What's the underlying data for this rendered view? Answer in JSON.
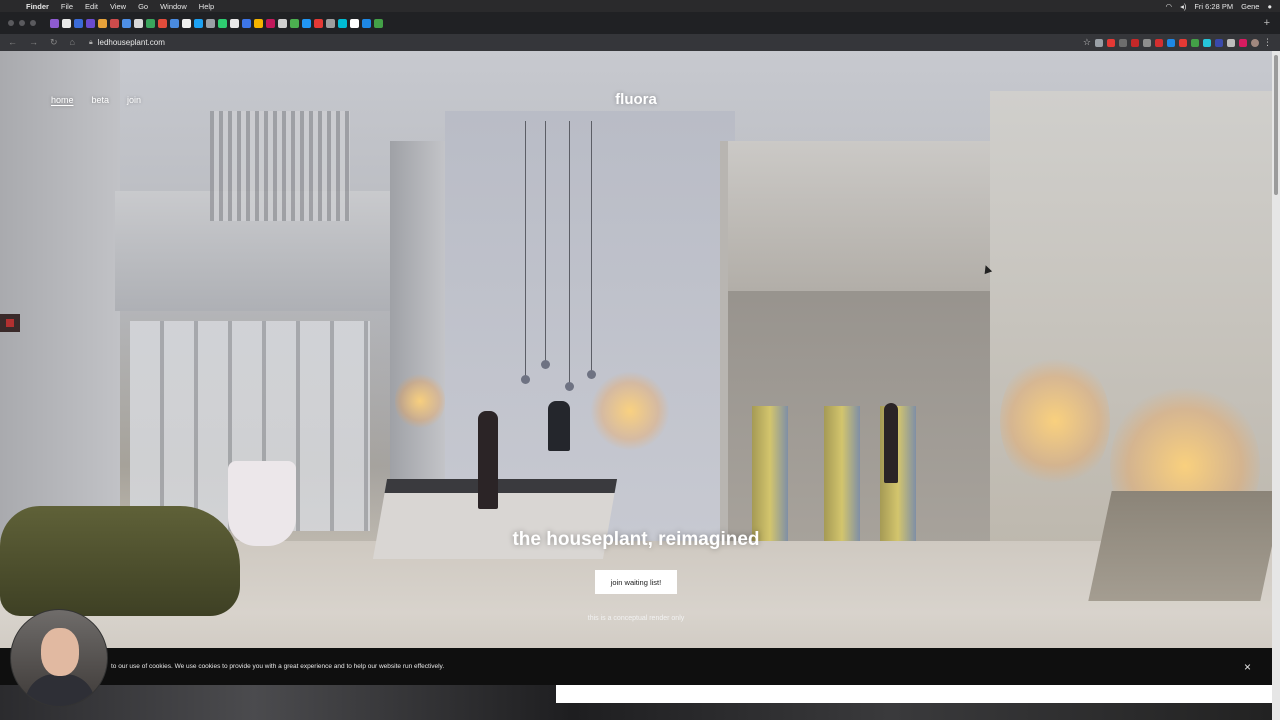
{
  "menubar": {
    "app": "Finder",
    "items": [
      "File",
      "Edit",
      "View",
      "Go",
      "Window",
      "Help"
    ],
    "clock": "Fri 6:28 PM",
    "user": "Gene"
  },
  "browser": {
    "url": "ledhouseplant.com",
    "new_tab": "+"
  },
  "site": {
    "nav": [
      "home",
      "beta",
      "join"
    ],
    "logo": "fluora",
    "hero_title": "the houseplant, reimagined",
    "cta_label": "join waiting list!",
    "note": "this is a conceptual render only"
  },
  "cookie": {
    "text": "to our use of cookies. We use cookies to provide you with a great experience and to help our website run effectively.",
    "close": "×"
  },
  "colors": {
    "menubar": "#2a2a2c",
    "tabstrip": "#202124",
    "toolbar": "#35363a",
    "cookie_banner": "#0f0f0f",
    "cta_bg": "#ffffff"
  }
}
